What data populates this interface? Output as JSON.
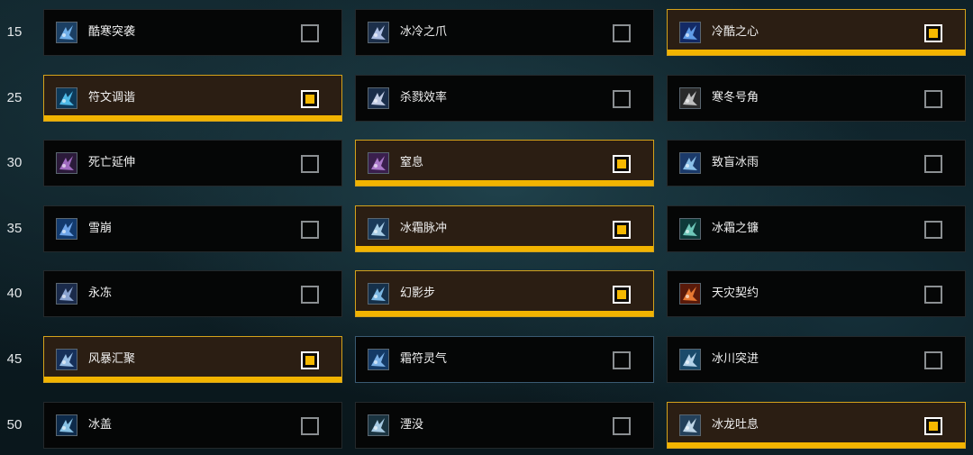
{
  "colors": {
    "selected_accent": "#f2b400",
    "selected_bg": "#2b1e13",
    "card_bg": "#050606",
    "hover_border": "#3a5a72"
  },
  "rows": [
    {
      "level": "15",
      "talents": [
        {
          "name": "酷寒突袭",
          "icon": "frost-strike-icon",
          "checked": false
        },
        {
          "name": "冰冷之爪",
          "icon": "icy-claw-icon",
          "checked": false
        },
        {
          "name": "冷酷之心",
          "icon": "cold-heart-icon",
          "checked": true
        }
      ]
    },
    {
      "level": "25",
      "talents": [
        {
          "name": "符文调谐",
          "icon": "rune-attunement-icon",
          "checked": true
        },
        {
          "name": "杀戮效率",
          "icon": "murderous-efficiency-icon",
          "checked": false
        },
        {
          "name": "寒冬号角",
          "icon": "horn-of-winter-icon",
          "checked": false
        }
      ]
    },
    {
      "level": "30",
      "talents": [
        {
          "name": "死亡延伸",
          "icon": "death-pact-icon",
          "checked": false
        },
        {
          "name": "窒息",
          "icon": "asphyxiate-icon",
          "checked": true
        },
        {
          "name": "致盲冰雨",
          "icon": "blinding-sleet-icon",
          "checked": false
        }
      ]
    },
    {
      "level": "35",
      "talents": [
        {
          "name": "雪崩",
          "icon": "avalanche-icon",
          "checked": false
        },
        {
          "name": "冰霜脉冲",
          "icon": "frozen-pulse-icon",
          "checked": true
        },
        {
          "name": "冰霜之镰",
          "icon": "frostscythe-icon",
          "checked": false
        }
      ]
    },
    {
      "level": "40",
      "talents": [
        {
          "name": "永冻",
          "icon": "permafrost-icon",
          "checked": false
        },
        {
          "name": "幻影步",
          "icon": "wraith-walk-icon",
          "checked": true
        },
        {
          "name": "天灾契约",
          "icon": "death-pact-scourge-icon",
          "checked": false
        }
      ]
    },
    {
      "level": "45",
      "talents": [
        {
          "name": "风暴汇聚",
          "icon": "gathering-storm-icon",
          "checked": true
        },
        {
          "name": "霜符灵气",
          "icon": "frostwyrm-aura-icon",
          "checked": false,
          "hover": true
        },
        {
          "name": "冰川突进",
          "icon": "glacial-advance-icon",
          "checked": false
        }
      ]
    },
    {
      "level": "50",
      "talents": [
        {
          "name": "冰盖",
          "icon": "icecap-icon",
          "checked": false
        },
        {
          "name": "湮没",
          "icon": "obliteration-icon",
          "checked": false
        },
        {
          "name": "冰龙吐息",
          "icon": "breath-of-sindragosa-icon",
          "checked": true
        }
      ]
    }
  ]
}
